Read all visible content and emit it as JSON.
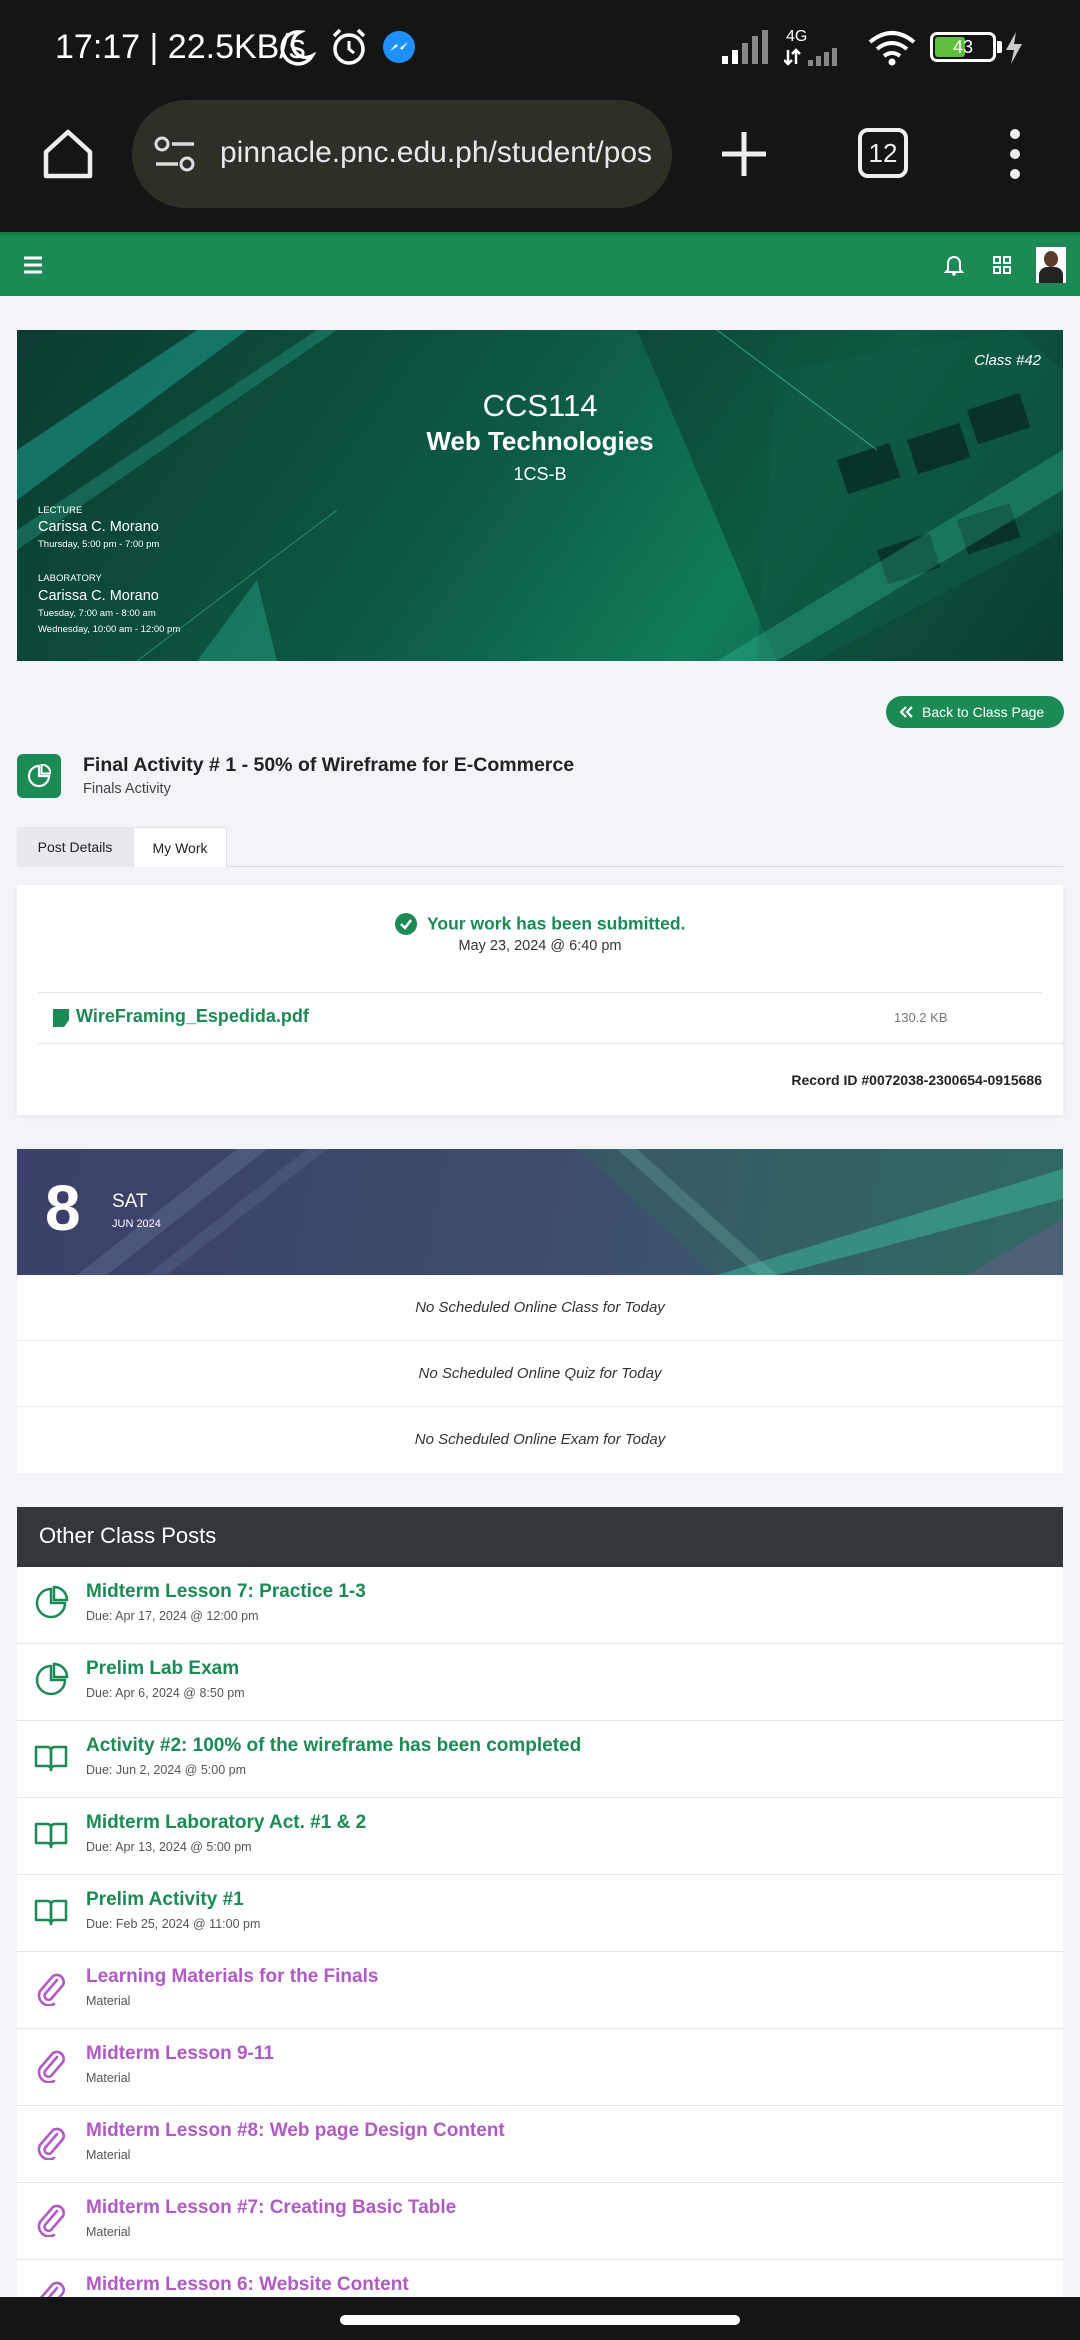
{
  "status_bar": {
    "time_speed": "17:17 | 22.5KB/s",
    "network": "4G",
    "battery": "43"
  },
  "browser": {
    "url": "pinnacle.pnc.edu.ph/student/pos",
    "tab_count": "12"
  },
  "banner": {
    "class_number": "Class #42",
    "course_code": "CCS114",
    "course_title": "Web Technologies",
    "section": "1CS-B",
    "lecture_label": "LECTURE",
    "lecture_instructor": "Carissa C. Morano",
    "lecture_schedule": "Thursday, 5:00 pm - 7:00 pm",
    "lab_label": "LABORATORY",
    "lab_instructor": "Carissa C. Morano",
    "lab_schedule_1": "Tuesday, 7:00 am - 8:00 am",
    "lab_schedule_2": "Wednesday, 10:00 am - 12:00 pm"
  },
  "back_button": "Back to Class Page",
  "post": {
    "title": "Final Activity # 1 - 50% of Wireframe for E-Commerce",
    "subtitle": "Finals Activity"
  },
  "tabs": [
    "Post Details",
    "My Work"
  ],
  "submission": {
    "message": "Your work has been submitted.",
    "date": "May 23, 2024 @ 6:40 pm",
    "file_name": "WireFraming_Espedida.pdf",
    "file_size": "130.2 KB",
    "record_id": "Record ID #0072038-2300654-0915686"
  },
  "calendar": {
    "day": "8",
    "weekday": "SAT",
    "month_year": "JUN 2024",
    "schedules": [
      "No Scheduled Online Class for Today",
      "No Scheduled Online Quiz for Today",
      "No Scheduled Online Exam for Today"
    ]
  },
  "other_posts": {
    "heading": "Other Class Posts",
    "items": [
      {
        "title": "Midterm Lesson 7: Practice 1-3",
        "sub": "Due: Apr 17, 2024 @ 12:00 pm",
        "icon": "pie-icon",
        "kind": "activity"
      },
      {
        "title": "Prelim Lab Exam",
        "sub": "Due: Apr 6, 2024 @ 8:50 pm",
        "icon": "pie-icon",
        "kind": "activity"
      },
      {
        "title": "Activity #2: 100% of the wireframe has been completed",
        "sub": "Due: Jun 2, 2024 @ 5:00 pm",
        "icon": "book-icon",
        "kind": "activity"
      },
      {
        "title": "Midterm Laboratory Act. #1 & 2",
        "sub": "Due: Apr 13, 2024 @ 5:00 pm",
        "icon": "book-icon",
        "kind": "activity"
      },
      {
        "title": "Prelim Activity #1",
        "sub": "Due: Feb 25, 2024 @ 11:00 pm",
        "icon": "book-icon",
        "kind": "activity"
      },
      {
        "title": "Learning Materials for the Finals",
        "sub": "Material",
        "icon": "paperclip-icon",
        "kind": "material"
      },
      {
        "title": "Midterm Lesson 9-11",
        "sub": "Material",
        "icon": "paperclip-icon",
        "kind": "material"
      },
      {
        "title": "Midterm Lesson #8: Web page Design Content",
        "sub": "Material",
        "icon": "paperclip-icon",
        "kind": "material"
      },
      {
        "title": "Midterm Lesson #7: Creating Basic Table",
        "sub": "Material",
        "icon": "paperclip-icon",
        "kind": "material"
      },
      {
        "title": "Midterm Lesson 6: Website Content",
        "sub": "",
        "icon": "paperclip-icon",
        "kind": "material"
      }
    ]
  },
  "colors": {
    "primary": "#1c8a55",
    "material": "#b05bc4",
    "dark": "#33373b"
  }
}
